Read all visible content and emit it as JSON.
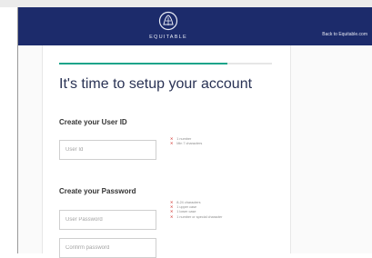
{
  "header": {
    "logo_text": "EQUITABLE",
    "logo_icon": "equitable-emblem-icon",
    "back_link": "Back to Equitable.com",
    "bg_color": "#1c2b6b"
  },
  "progress": {
    "value": 0.79,
    "color": "#1ba48a"
  },
  "main": {
    "title": "It's time to setup your account",
    "user_id": {
      "heading": "Create your User ID",
      "placeholder": "User Id",
      "requirements": [
        "1 number",
        "Min 7 characters"
      ]
    },
    "password": {
      "heading": "Create your Password",
      "placeholder": "User Password",
      "confirm_placeholder": "Confirm password",
      "requirements": [
        "8-24 characters",
        "1 upper case",
        "1 lower case",
        "1 number or special character"
      ]
    }
  },
  "requirement_status_color": "#d9534f"
}
